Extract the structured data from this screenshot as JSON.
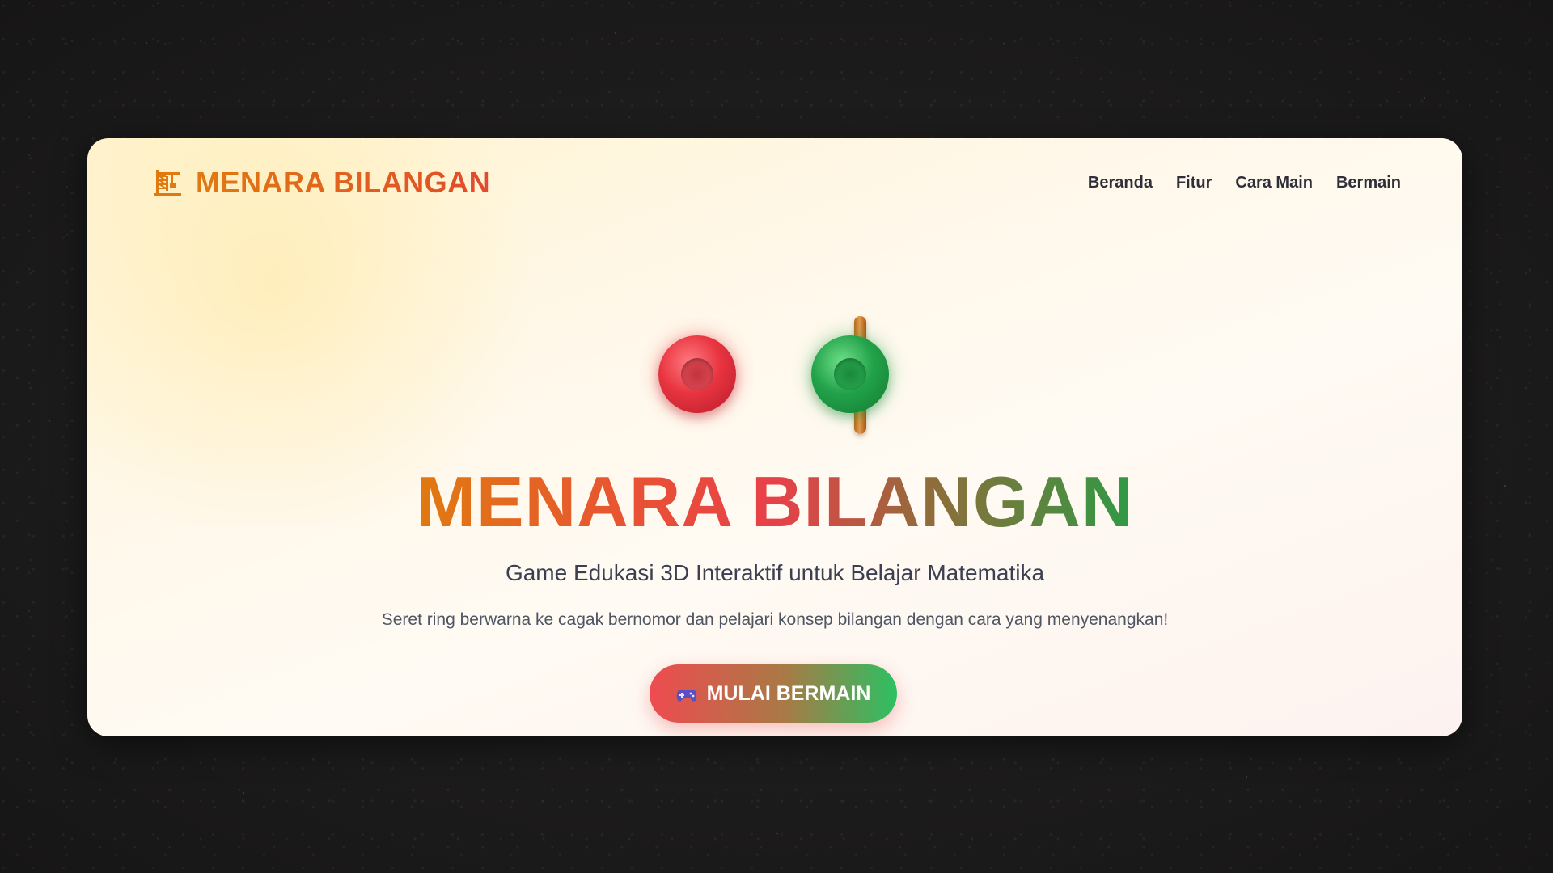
{
  "brand": {
    "title": "MENARA BILANGAN",
    "icon": "tower-crane-icon"
  },
  "nav": {
    "items": [
      {
        "label": "Beranda"
      },
      {
        "label": "Fitur"
      },
      {
        "label": "Cara Main"
      },
      {
        "label": "Bermain"
      }
    ]
  },
  "hero": {
    "title": "MENARA BILANGAN",
    "subtitle": "Game Edukasi 3D Interaktif untuk Belajar Matematika",
    "description": "Seret ring berwarna ke cagak bernomor dan pelajari konsep bilangan dengan cara yang menyenangkan!",
    "cta_label": "MULAI BERMAIN",
    "cta_icon": "gamepad-icon",
    "graphic": {
      "rings": [
        {
          "color": "#e83440"
        },
        {
          "color": "#22a24a"
        }
      ],
      "peg_color": "#d98a3c"
    }
  },
  "colors": {
    "brand_orange": "#e07a10",
    "brand_red": "#e8404a",
    "brand_green": "#2f9a45",
    "nav_text": "#2f2f3a",
    "background": "#1c1b1b"
  }
}
